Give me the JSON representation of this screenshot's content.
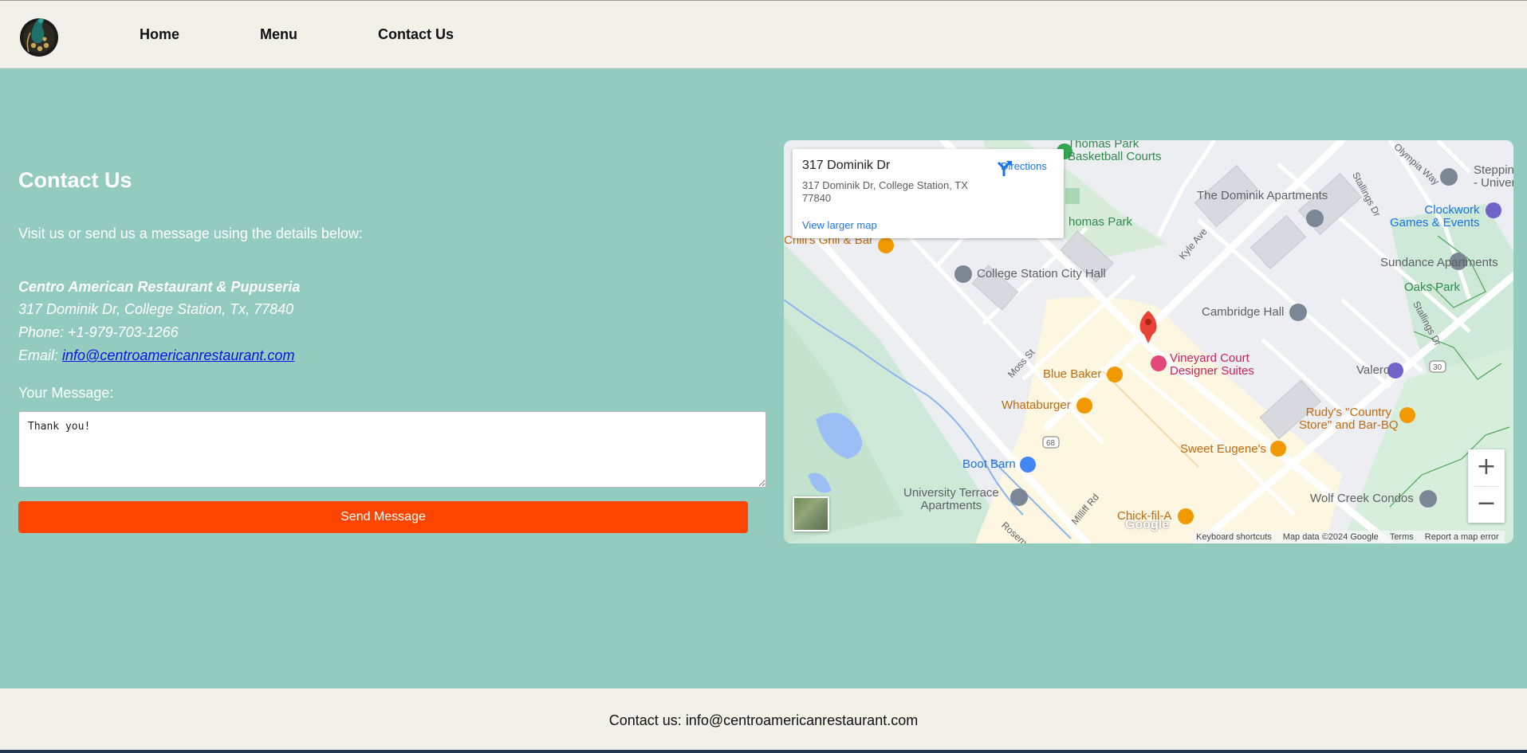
{
  "nav": {
    "logo_icon": "peacock-logo-icon",
    "items": [
      {
        "label": "Home"
      },
      {
        "label": "Menu"
      },
      {
        "label": "Contact Us"
      }
    ]
  },
  "contact": {
    "title": "Contact Us",
    "intro": "Visit us or send us a message using the details below:",
    "restaurant_name": "Centro American Restaurant & Pupuseria",
    "address": "317 Dominik Dr, College Station, Tx, 77840",
    "phone": "Phone: +1-979-703-1266",
    "email_prefix": "Email:",
    "email": "info@centroamericanrestaurant.com",
    "message_label": "Your Message:",
    "message_value": "Thank you!",
    "send_label": "Send Message"
  },
  "map": {
    "card_title": "317 Dominik Dr",
    "card_address": "317 Dominik Dr, College Station, TX 77840",
    "directions_label": "Directions",
    "larger_map_label": "View larger map",
    "zoom_in": "+",
    "zoom_out": "−",
    "google_logo": "Google",
    "attribution": [
      "Keyboard shortcuts",
      "Map data ©2024 Google",
      "Terms",
      "Report a map error"
    ],
    "places": [
      {
        "name": "Thomas Park\nBasketball Courts"
      },
      {
        "name": "The Dominik Apartments"
      },
      {
        "name": "Clockwork\nGames & Events"
      },
      {
        "name": "Sundance Apartments"
      },
      {
        "name": "Oaks Park"
      },
      {
        "name": "College Station City Hall"
      },
      {
        "name": "homas Park"
      },
      {
        "name": "Cambridge Hall"
      },
      {
        "name": "Chili's Grill & Bar"
      },
      {
        "name": "Blue Baker"
      },
      {
        "name": "Vineyard Court\nDesigner Suites"
      },
      {
        "name": "Valero"
      },
      {
        "name": "Whataburger"
      },
      {
        "name": "Rudy's \"Country\nStore\" and Bar-BQ"
      },
      {
        "name": "Sweet Eugene's"
      },
      {
        "name": "Boot Barn"
      },
      {
        "name": "University Terrace\nApartments"
      },
      {
        "name": "Wolf Creek Condos"
      },
      {
        "name": "Chick-fil-A"
      },
      {
        "name": "Steppin\n- Univer"
      }
    ],
    "streets": [
      "Kyle Ave",
      "Stallings Dr",
      "Olympia Way",
      "Moss St",
      "Milliff Rd",
      "Rosem",
      "Stallings Dr",
      "68",
      "30"
    ]
  },
  "footer": {
    "text": "Contact us: info@centroamericanrestaurant.com"
  },
  "colors": {
    "page_bg": "#93ccbe",
    "nav_bg": "#f1f1e9",
    "button": "#fe4500",
    "link": "#0b12e8"
  }
}
